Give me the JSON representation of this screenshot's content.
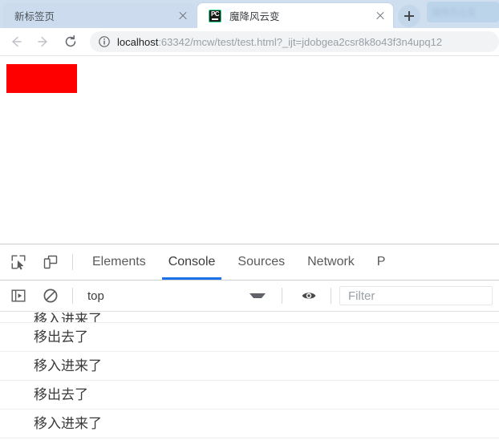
{
  "browser": {
    "tabs": [
      {
        "title": "新标签页",
        "active": false,
        "favicon": "none",
        "close_icon": "close-icon"
      },
      {
        "title": "魔降风云变",
        "active": true,
        "favicon": "pycharm-icon",
        "close_icon": "close-icon"
      }
    ],
    "new_tab_label": "+",
    "window_ghost_text": "魔降风云变",
    "toolbar": {
      "back_icon": "back-arrow-icon",
      "forward_icon": "forward-arrow-icon",
      "reload_icon": "reload-icon",
      "info_icon": "page-info-icon",
      "url_host": "localhost",
      "url_rest": ":63342/mcw/test/test.html?_ijt=jdobgea2csr8k8o43f3n4upq12",
      "url_full": "localhost:63342/mcw/test/test.html?_ijt=jdobgea2csr8k8o43f3n4upq12"
    }
  },
  "page": {
    "box_color": "#ff0000"
  },
  "devtools": {
    "inspect_icon": "inspect-element-icon",
    "device_icon": "device-toolbar-icon",
    "tabs": [
      {
        "label": "Elements",
        "selected": false
      },
      {
        "label": "Console",
        "selected": true
      },
      {
        "label": "Sources",
        "selected": false
      },
      {
        "label": "Network",
        "selected": false
      },
      {
        "label": "P",
        "selected": false
      }
    ],
    "console_toolbar": {
      "sidebar_icon": "console-sidebar-icon",
      "clear_icon": "clear-console-icon",
      "context": "top",
      "context_arrow_icon": "chevron-down-icon",
      "eye_icon": "live-expression-eye-icon",
      "filter_placeholder": "Filter",
      "filter_value": ""
    },
    "console_messages": [
      {
        "text": "移入进来了",
        "clipped": true
      },
      {
        "text": "移出去了",
        "clipped": false
      },
      {
        "text": "移入进来了",
        "clipped": false
      },
      {
        "text": "移出去了",
        "clipped": false
      },
      {
        "text": "移入进来了",
        "clipped": false
      }
    ]
  },
  "colors": {
    "accent": "#1a73e8",
    "tabstrip": "#cfdff0",
    "box_red": "#ff0000"
  }
}
